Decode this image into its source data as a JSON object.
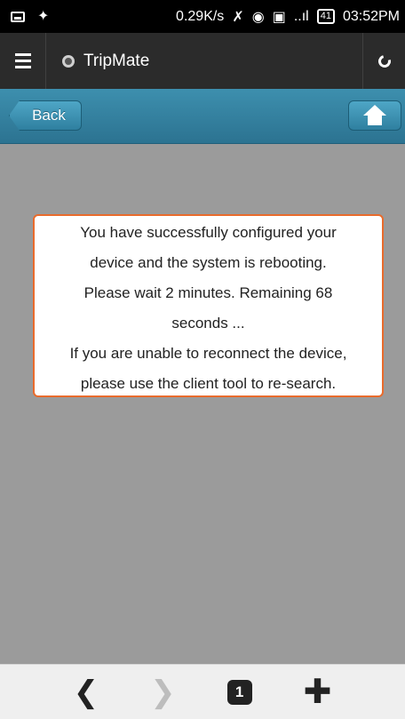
{
  "status_bar": {
    "speed": "0.29K/s",
    "signal_text": "..ıl",
    "battery": "41",
    "time": "03:52PM",
    "icons": [
      "picture-icon",
      "satellite-icon",
      "mute-icon",
      "wifi-icon",
      "no-sim-icon",
      "signal-icon",
      "battery-icon"
    ]
  },
  "browser": {
    "tab_title": "TripMate",
    "tab_count": "1"
  },
  "header": {
    "back_label": "Back",
    "accent_color": "#2c7391"
  },
  "dialog": {
    "lines": [
      "You have successfully configured your",
      "device and the system is rebooting.",
      "Please wait 2 minutes. Remaining 68",
      "seconds ...",
      "If you are unable to reconnect the device,",
      "please use the client tool to re-search."
    ],
    "border_color": "#e96b2c"
  },
  "bottom_nav": {
    "back_glyph": "❮",
    "forward_glyph": "❯",
    "new_tab_glyph": "✚"
  }
}
